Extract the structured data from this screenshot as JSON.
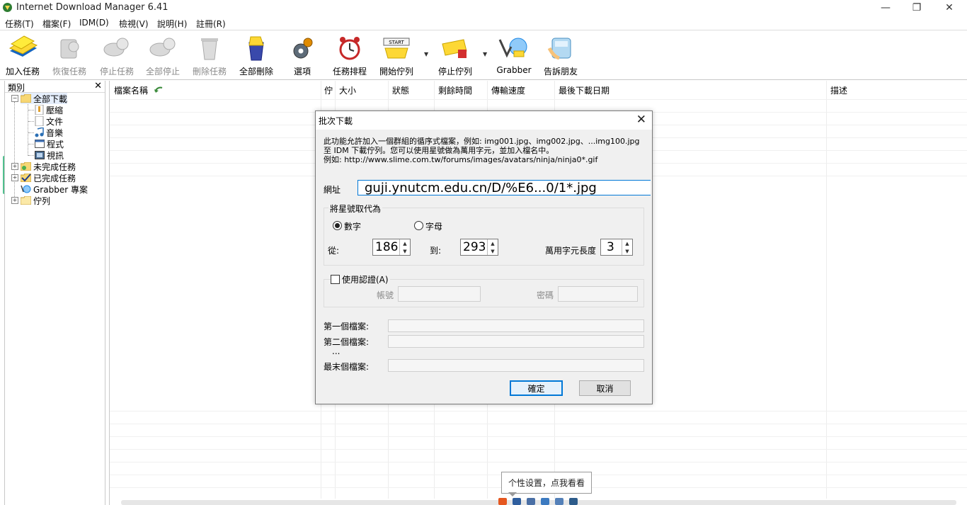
{
  "window": {
    "title": "Internet Download Manager 6.41"
  },
  "menu": {
    "items": [
      "任務(T)",
      "檔案(F)",
      "IDM(D)",
      "檢視(V)",
      "說明(H)",
      "註冊(R)"
    ]
  },
  "toolbar": {
    "add": "加入任務",
    "resume": "恢復任務",
    "stop": "停止任務",
    "stop_all": "全部停止",
    "delete": "刪除任務",
    "delete_all": "全部刪除",
    "options": "選項",
    "scheduler": "任務排程",
    "start_queue": "開始佇列",
    "stop_queue": "停止佇列",
    "grabber": "Grabber",
    "tell_friend": "告訴朋友",
    "start_badge": "START"
  },
  "sidebar": {
    "title": "類別",
    "close": "✕",
    "items": [
      "全部下載",
      "壓縮",
      "文件",
      "音樂",
      "程式",
      "視訊",
      "未完成任務",
      "已完成任務",
      "Grabber 專案",
      "佇列"
    ]
  },
  "columns": [
    "檔案名稱",
    "佇",
    "大小",
    "狀態",
    "剩餘時間",
    "傳輸速度",
    "最後下載日期",
    "描述"
  ],
  "dialog": {
    "title": "批次下載",
    "close": "✕",
    "desc1": "此功能允許加入一個群組的循序式檔案，例如: img001.jpg、img002.jpg、...img100.jpg",
    "desc2": "至 IDM 下載佇列。您可以使用星號做為萬用字元，並加入檔名中。",
    "desc3": "例如: http://www.slime.com.tw/forums/images/avatars/ninja/ninja0*.gif",
    "url_label": "網址",
    "url_value": "guji.ynutcm.edu.cn/D/%E6...0/1*.jpg",
    "replace_group": "將星號取代為",
    "radio_number": "數字",
    "radio_letter": "字母",
    "from_label": "從:",
    "from_value": "186",
    "to_label": "到:",
    "to_value": "293",
    "wildcard_label": "萬用字元長度",
    "wildcard_value": "3",
    "auth_label": "使用認證(A)",
    "user_label": "帳號",
    "pass_label": "密碼",
    "first_file": "第一個檔案:",
    "second_file": "第二個檔案:",
    "ellipsis": "...",
    "last_file": "最末個檔案:",
    "ok": "確定",
    "cancel": "取消"
  },
  "tooltip": {
    "text": "个性设置，点我看看"
  },
  "window_controls": {
    "minimize": "—",
    "restore": "❐",
    "close": "✕"
  }
}
